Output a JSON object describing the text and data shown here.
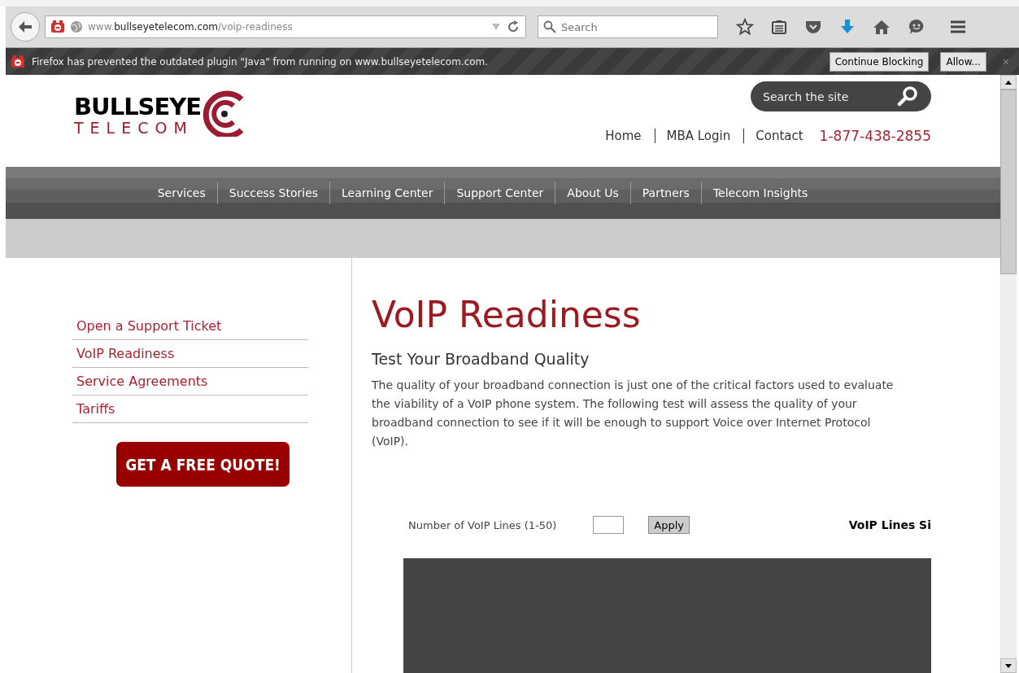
{
  "browser": {
    "url_prefix": "www.",
    "url_domain": "bullseyetelecom.com",
    "url_path": "/voip-readiness",
    "search_placeholder": "Search"
  },
  "notification": {
    "message": "Firefox has prevented the outdated plugin \"Java\" from running on www.bullseyetelecom.com.",
    "buttons": [
      "Continue Blocking",
      "Allow..."
    ],
    "close": "×"
  },
  "header": {
    "logo_top": "BULLSEYE",
    "logo_bottom": "TELECOM",
    "site_search_placeholder": "Search the site",
    "links": [
      "Home",
      "MBA Login",
      "Contact"
    ],
    "phone": "1-877-438-2855"
  },
  "nav": [
    "Services",
    "Success Stories",
    "Learning Center",
    "Support Center",
    "About Us",
    "Partners",
    "Telecom Insights"
  ],
  "sidebar": {
    "items": [
      "Open a Support Ticket",
      "VoIP Readiness",
      "Service Agreements",
      "Tariffs"
    ],
    "cta": "GET A FREE QUOTE!"
  },
  "content": {
    "title": "VoIP Readiness",
    "subtitle": "Test Your Broadband Quality",
    "paragraph": "The quality of your broadband connection is just one of the critical factors used to evaluate the viability of a VoIP phone system. The following test will assess the quality of your broadband connection to see if it will be enough to support Voice over Internet Protocol (VoIP).",
    "lines_label": "Number of VoIP Lines (1-50)",
    "apply": "Apply",
    "side_heading": "VoIP Lines Si"
  }
}
